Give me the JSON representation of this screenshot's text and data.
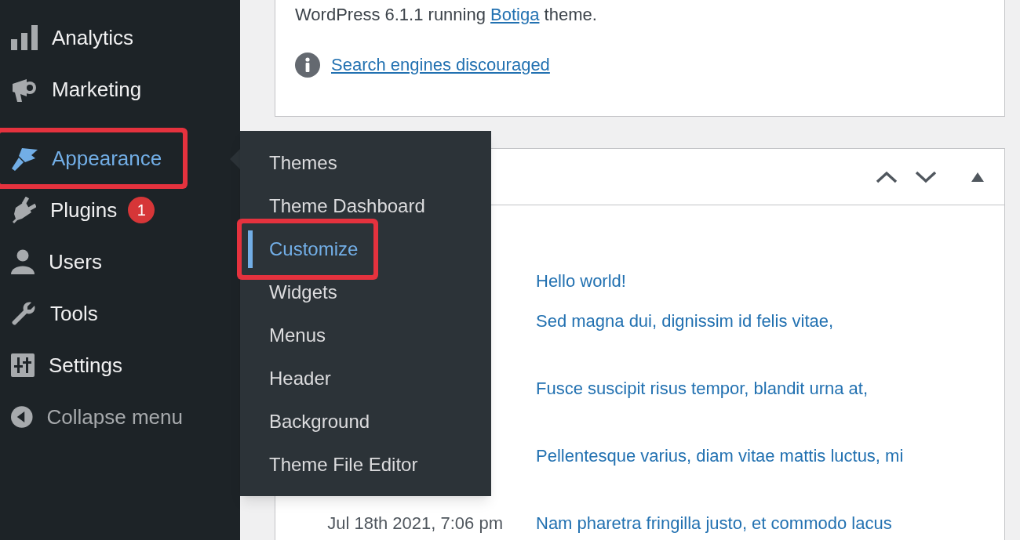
{
  "sidebar": {
    "items": [
      {
        "label": "Analytics",
        "selected": false,
        "highlighted": false
      },
      {
        "label": "Marketing",
        "selected": false,
        "highlighted": false
      },
      {
        "label": "Appearance",
        "selected": true,
        "highlighted": true
      },
      {
        "label": "Plugins",
        "selected": false,
        "highlighted": false,
        "badge": "1"
      },
      {
        "label": "Users",
        "selected": false,
        "highlighted": false
      },
      {
        "label": "Tools",
        "selected": false,
        "highlighted": false
      },
      {
        "label": "Settings",
        "selected": false,
        "highlighted": false
      },
      {
        "label": "Collapse menu",
        "kind": "collapse",
        "selected": false,
        "highlighted": false
      }
    ]
  },
  "submenu": {
    "items": [
      {
        "label": "Themes",
        "selected": false,
        "highlighted": false
      },
      {
        "label": "Theme Dashboard",
        "selected": false,
        "highlighted": false
      },
      {
        "label": "Customize",
        "selected": true,
        "highlighted": true
      },
      {
        "label": "Widgets",
        "selected": false,
        "highlighted": false
      },
      {
        "label": "Menus",
        "selected": false,
        "highlighted": false
      },
      {
        "label": "Header",
        "selected": false,
        "highlighted": false
      },
      {
        "label": "Background",
        "selected": false,
        "highlighted": false
      },
      {
        "label": "Theme File Editor",
        "selected": false,
        "highlighted": false
      }
    ]
  },
  "glance": {
    "version_text": {
      "before": "WordPress 6.1.1 running ",
      "link": "Botiga",
      "after": " theme."
    },
    "notice": "Search engines discouraged"
  },
  "activity": {
    "rows": [
      {
        "title": "Hello world!"
      },
      {
        "title": "Sed magna dui, dignissim id felis vitae,"
      },
      {
        "title": "Fusce suscipit risus tempor, blandit urna at,"
      },
      {
        "title": "Pellentesque varius, diam vitae mattis luctus, mi"
      },
      {
        "date": "Jul 18th 2021, 7:06 pm",
        "title": "Nam pharetra fringilla justo, et commodo lacus"
      }
    ]
  }
}
